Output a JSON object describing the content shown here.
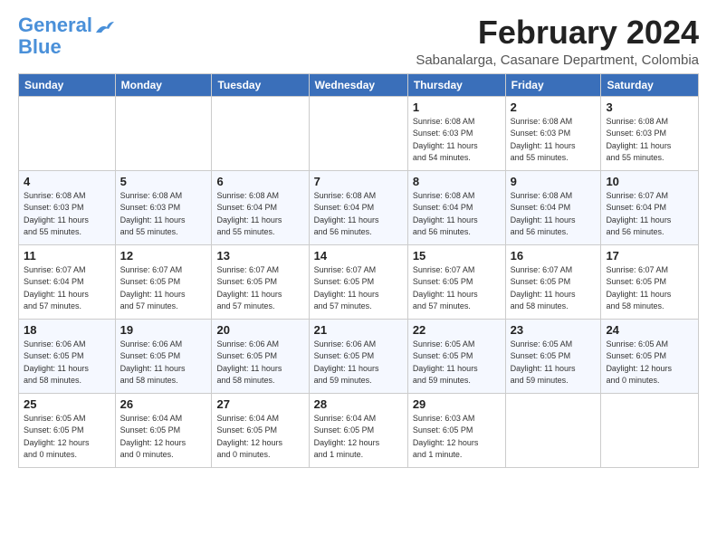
{
  "logo": {
    "line1": "General",
    "line2": "Blue"
  },
  "header": {
    "month": "February 2024",
    "location": "Sabanalarga, Casanare Department, Colombia"
  },
  "weekdays": [
    "Sunday",
    "Monday",
    "Tuesday",
    "Wednesday",
    "Thursday",
    "Friday",
    "Saturday"
  ],
  "weeks": [
    [
      {
        "day": "",
        "info": ""
      },
      {
        "day": "",
        "info": ""
      },
      {
        "day": "",
        "info": ""
      },
      {
        "day": "",
        "info": ""
      },
      {
        "day": "1",
        "info": "Sunrise: 6:08 AM\nSunset: 6:03 PM\nDaylight: 11 hours\nand 54 minutes."
      },
      {
        "day": "2",
        "info": "Sunrise: 6:08 AM\nSunset: 6:03 PM\nDaylight: 11 hours\nand 55 minutes."
      },
      {
        "day": "3",
        "info": "Sunrise: 6:08 AM\nSunset: 6:03 PM\nDaylight: 11 hours\nand 55 minutes."
      }
    ],
    [
      {
        "day": "4",
        "info": "Sunrise: 6:08 AM\nSunset: 6:03 PM\nDaylight: 11 hours\nand 55 minutes."
      },
      {
        "day": "5",
        "info": "Sunrise: 6:08 AM\nSunset: 6:03 PM\nDaylight: 11 hours\nand 55 minutes."
      },
      {
        "day": "6",
        "info": "Sunrise: 6:08 AM\nSunset: 6:04 PM\nDaylight: 11 hours\nand 55 minutes."
      },
      {
        "day": "7",
        "info": "Sunrise: 6:08 AM\nSunset: 6:04 PM\nDaylight: 11 hours\nand 56 minutes."
      },
      {
        "day": "8",
        "info": "Sunrise: 6:08 AM\nSunset: 6:04 PM\nDaylight: 11 hours\nand 56 minutes."
      },
      {
        "day": "9",
        "info": "Sunrise: 6:08 AM\nSunset: 6:04 PM\nDaylight: 11 hours\nand 56 minutes."
      },
      {
        "day": "10",
        "info": "Sunrise: 6:07 AM\nSunset: 6:04 PM\nDaylight: 11 hours\nand 56 minutes."
      }
    ],
    [
      {
        "day": "11",
        "info": "Sunrise: 6:07 AM\nSunset: 6:04 PM\nDaylight: 11 hours\nand 57 minutes."
      },
      {
        "day": "12",
        "info": "Sunrise: 6:07 AM\nSunset: 6:05 PM\nDaylight: 11 hours\nand 57 minutes."
      },
      {
        "day": "13",
        "info": "Sunrise: 6:07 AM\nSunset: 6:05 PM\nDaylight: 11 hours\nand 57 minutes."
      },
      {
        "day": "14",
        "info": "Sunrise: 6:07 AM\nSunset: 6:05 PM\nDaylight: 11 hours\nand 57 minutes."
      },
      {
        "day": "15",
        "info": "Sunrise: 6:07 AM\nSunset: 6:05 PM\nDaylight: 11 hours\nand 57 minutes."
      },
      {
        "day": "16",
        "info": "Sunrise: 6:07 AM\nSunset: 6:05 PM\nDaylight: 11 hours\nand 58 minutes."
      },
      {
        "day": "17",
        "info": "Sunrise: 6:07 AM\nSunset: 6:05 PM\nDaylight: 11 hours\nand 58 minutes."
      }
    ],
    [
      {
        "day": "18",
        "info": "Sunrise: 6:06 AM\nSunset: 6:05 PM\nDaylight: 11 hours\nand 58 minutes."
      },
      {
        "day": "19",
        "info": "Sunrise: 6:06 AM\nSunset: 6:05 PM\nDaylight: 11 hours\nand 58 minutes."
      },
      {
        "day": "20",
        "info": "Sunrise: 6:06 AM\nSunset: 6:05 PM\nDaylight: 11 hours\nand 58 minutes."
      },
      {
        "day": "21",
        "info": "Sunrise: 6:06 AM\nSunset: 6:05 PM\nDaylight: 11 hours\nand 59 minutes."
      },
      {
        "day": "22",
        "info": "Sunrise: 6:05 AM\nSunset: 6:05 PM\nDaylight: 11 hours\nand 59 minutes."
      },
      {
        "day": "23",
        "info": "Sunrise: 6:05 AM\nSunset: 6:05 PM\nDaylight: 11 hours\nand 59 minutes."
      },
      {
        "day": "24",
        "info": "Sunrise: 6:05 AM\nSunset: 6:05 PM\nDaylight: 12 hours\nand 0 minutes."
      }
    ],
    [
      {
        "day": "25",
        "info": "Sunrise: 6:05 AM\nSunset: 6:05 PM\nDaylight: 12 hours\nand 0 minutes."
      },
      {
        "day": "26",
        "info": "Sunrise: 6:04 AM\nSunset: 6:05 PM\nDaylight: 12 hours\nand 0 minutes."
      },
      {
        "day": "27",
        "info": "Sunrise: 6:04 AM\nSunset: 6:05 PM\nDaylight: 12 hours\nand 0 minutes."
      },
      {
        "day": "28",
        "info": "Sunrise: 6:04 AM\nSunset: 6:05 PM\nDaylight: 12 hours\nand 1 minute."
      },
      {
        "day": "29",
        "info": "Sunrise: 6:03 AM\nSunset: 6:05 PM\nDaylight: 12 hours\nand 1 minute."
      },
      {
        "day": "",
        "info": ""
      },
      {
        "day": "",
        "info": ""
      }
    ]
  ]
}
